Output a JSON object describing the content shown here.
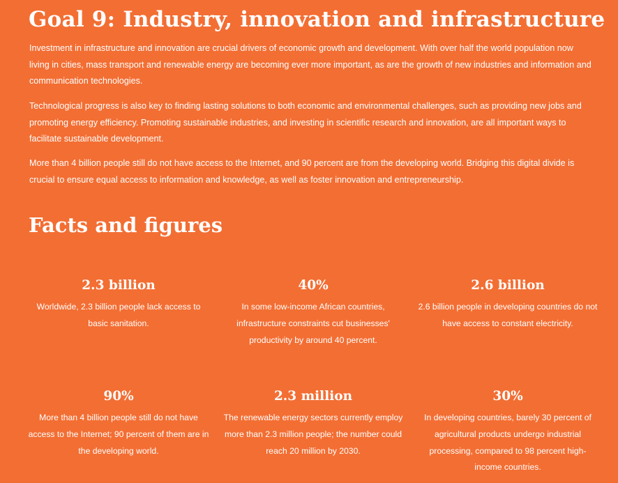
{
  "goal": {
    "title": "Goal 9: Industry, innovation and infrastructure",
    "paragraphs": [
      "Investment in infrastructure and innovation are crucial drivers of economic growth and development. With over half the world population now living in cities, mass transport and renewable energy are becoming ever more important, as are the growth of new industries and information and communication technologies.",
      "Technological progress is also key to finding lasting solutions to both economic and environmental challenges, such as providing new jobs and promoting energy efficiency. Promoting sustainable industries, and investing in scientific research and innovation, are all important ways to facilitate sustainable development.",
      "More than 4 billion people still do not have access to the Internet, and 90 percent are from the developing world. Bridging this digital divide is crucial to ensure equal access to information and knowledge, as well as foster innovation and entrepreneurship."
    ]
  },
  "facts": {
    "title": "Facts and figures",
    "items": [
      {
        "value": "2.3 billion",
        "text": "Worldwide, 2.3 billion people lack access to basic sanitation."
      },
      {
        "value": "40%",
        "text": "In some low-income African countries, infrastructure constraints cut businesses' productivity by around 40 percent."
      },
      {
        "value": "2.6 billion",
        "text": "2.6 billion people in developing countries do not have access to constant electricity."
      },
      {
        "value": "90%",
        "text": "More than 4 billion people still do not have access to the Internet; 90 percent of them are in the developing world."
      },
      {
        "value": "2.3 million",
        "text": "The renewable energy sectors currently employ more than 2.3 million people; the number could reach 20 million by 2030."
      },
      {
        "value": "30%",
        "text": "In developing countries, barely 30 percent of agricultural products undergo industrial processing, compared to 98 percent high-income countries."
      }
    ]
  },
  "colors": {
    "background": "#f36e33",
    "text": "#ffffff"
  }
}
